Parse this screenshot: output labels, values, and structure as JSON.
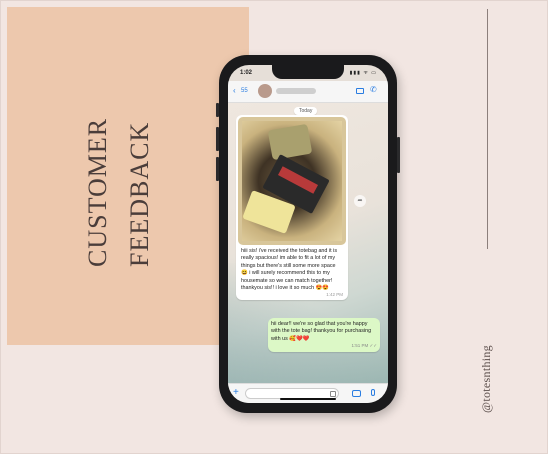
{
  "title": {
    "line1": "CUSTOMER",
    "line2": "FEEDBACK"
  },
  "handle": "@totesnthing",
  "phone": {
    "status_time": "1:02",
    "status_icons": "▮▮▮ ᯤ ▭",
    "header": {
      "back_glyph": "‹",
      "back_count": "55",
      "phone_glyph": "✆"
    },
    "date_chip": "Today",
    "incoming": {
      "text": "hiii sis! i've received the totebag and it is really spacious! im able to fit a lot of my things but there's still some more space 😆 i will surely recommend this to my housemate so we can match together! thankyou sis!! i love it so much 😍😍",
      "time": "1:42 PM"
    },
    "outgoing": {
      "text": "hii dear!! we're so glad that you're happy with the tote bag! thankyou for purchasing with us 🥰❤️❤️",
      "time": "1:51 PM ✓✓"
    },
    "forward_glyph": "➦",
    "input_plus": "+"
  },
  "colors": {
    "peach": "#edc8ad",
    "background": "#f2e6e2",
    "outgoing_bubble": "#dcf8c6",
    "accent": "#2a7de1"
  }
}
